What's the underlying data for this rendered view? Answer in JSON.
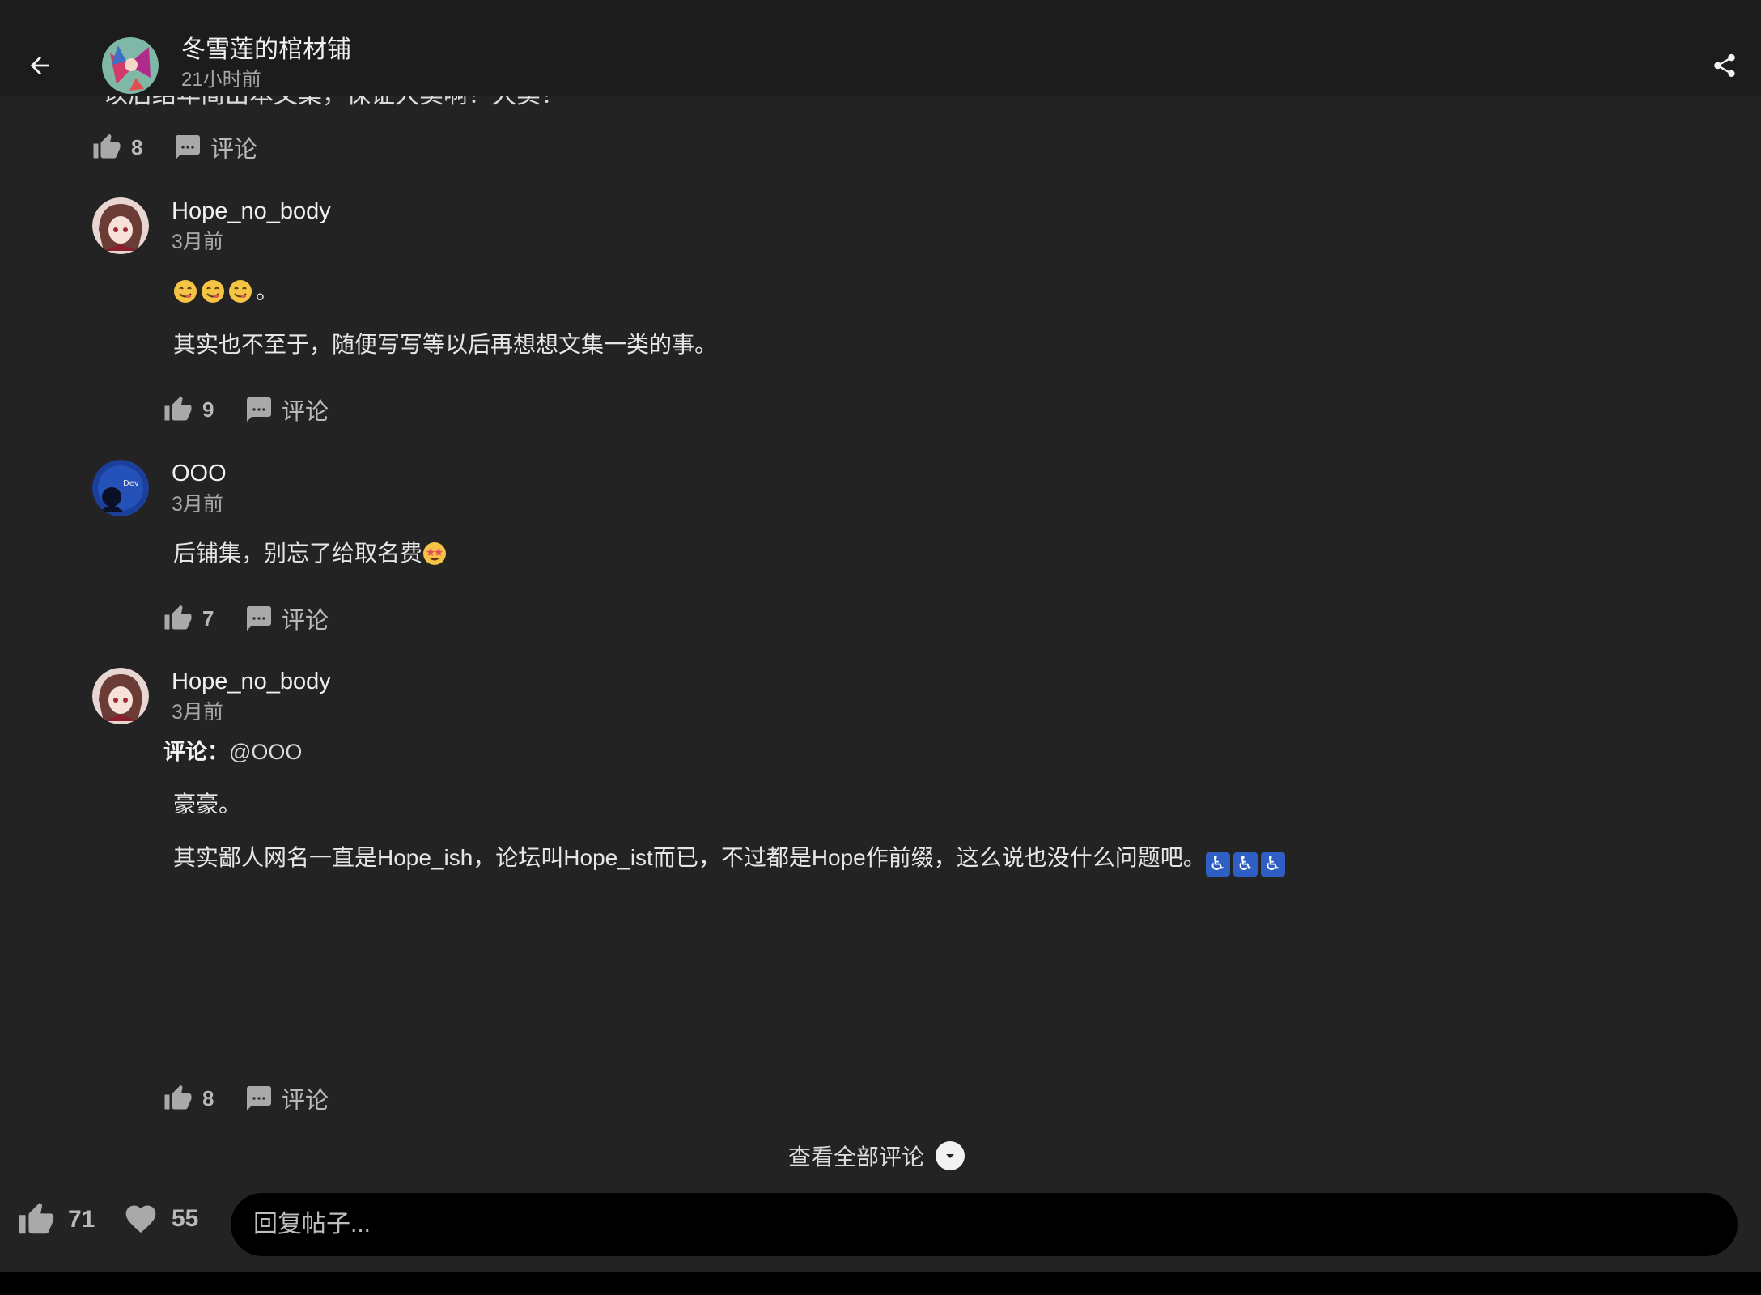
{
  "header": {
    "title": "冬雪莲的棺材铺",
    "time": "21小时前"
  },
  "previous_comment": {
    "cut_text": "以后结年简出本文集，保证大卖啊！大卖！",
    "likes": "8",
    "comment_label": "评论"
  },
  "comments": [
    {
      "user": "Hope_no_body",
      "time": "3月前",
      "line1": "。",
      "line2": "其实也不至于，随便写写等以后再想想文集一类的事。",
      "likes": "9",
      "comment_label": "评论"
    },
    {
      "user": "OOO",
      "time": "3月前",
      "line1": "后铺集，别忘了给取名费",
      "likes": "7",
      "comment_label": "评论"
    },
    {
      "user": "Hope_no_body",
      "time": "3月前",
      "reply_label": "评论：",
      "reply_to": "@OOO",
      "line1": "豪豪。",
      "line2": "其实鄙人网名一直是Hope_ish，论坛叫Hope_ist而已，不过都是Hope作前缀，这么说也没什么问题吧。",
      "likes": "8",
      "comment_label": "评论"
    }
  ],
  "view_all": "查看全部评论",
  "bottom_bar": {
    "likes": "71",
    "favorites": "55",
    "reply_placeholder": "回复帖子..."
  },
  "colors": {
    "background": "#232323",
    "header": "#1c1c1c",
    "input": "#000000",
    "muted_text": "#a8a8a8",
    "emoji_accessible": "#2f5fc4"
  },
  "icons": [
    "back-arrow-icon",
    "share-icon",
    "thumbs-up-icon",
    "comment-bubble-icon",
    "heart-icon",
    "chevron-down-icon",
    "yum-emoji-icon",
    "star-struck-emoji-icon",
    "wheelchair-emoji-icon"
  ]
}
